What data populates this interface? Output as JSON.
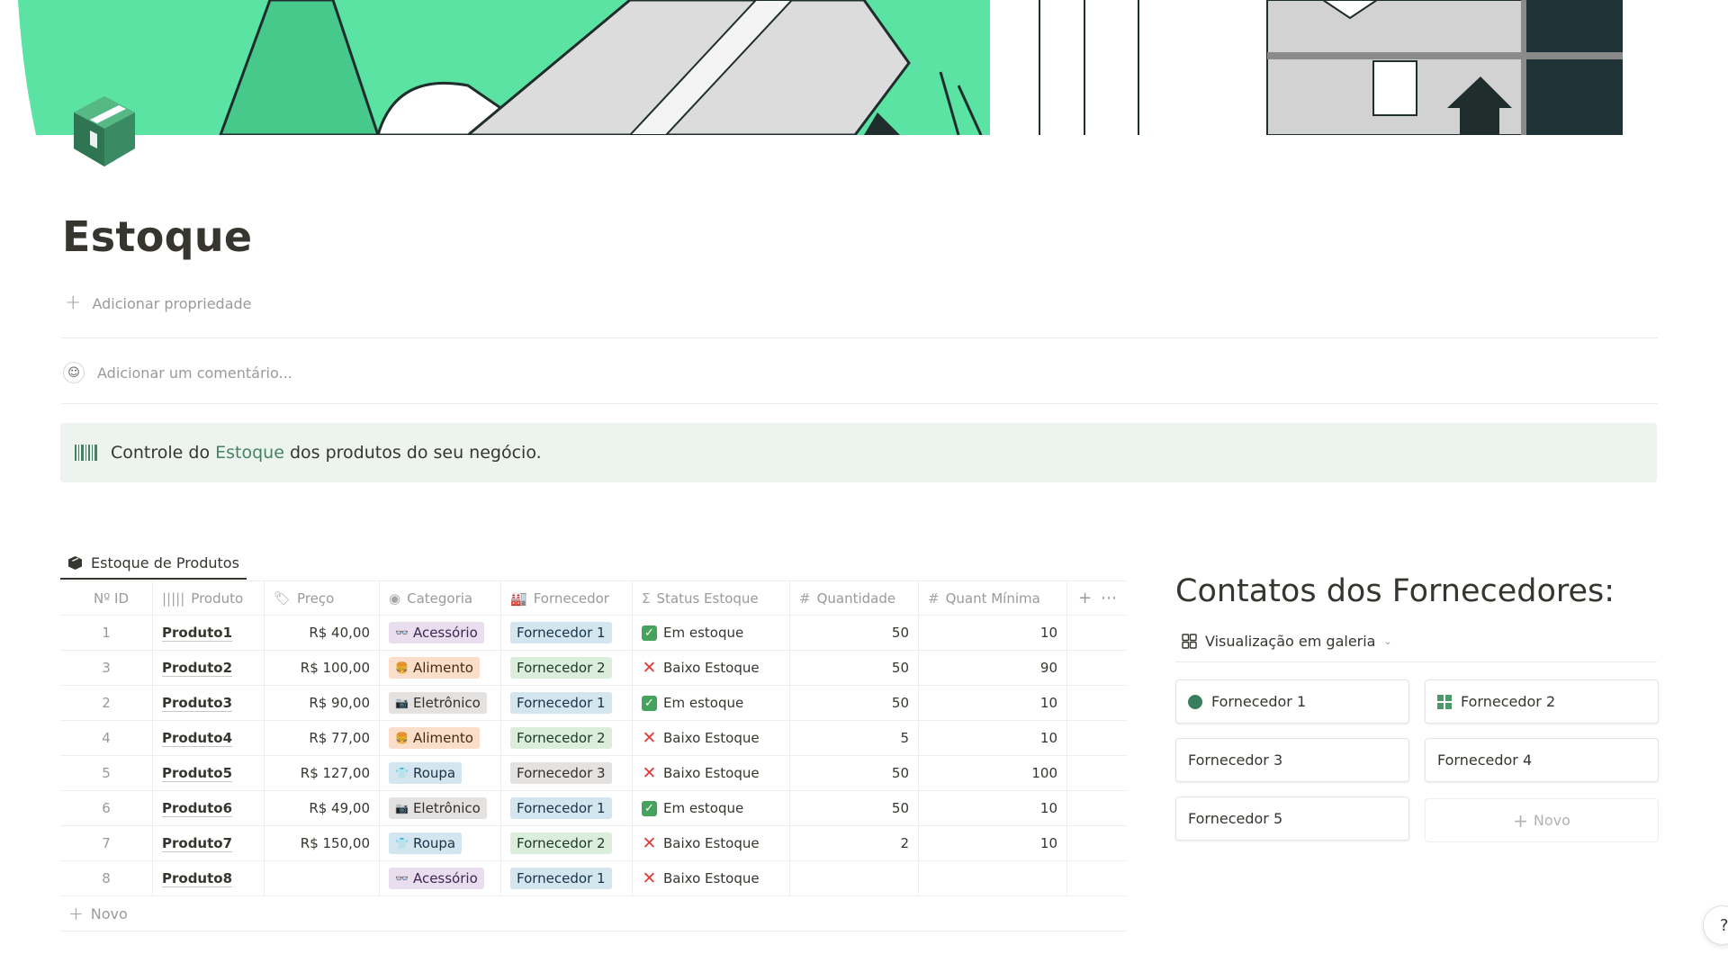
{
  "page": {
    "title": "Estoque",
    "add_property": "Adicionar propriedade",
    "comment_placeholder": "Adicionar um comentário..."
  },
  "callout": {
    "text_before": "Controle do ",
    "highlight": "Estoque",
    "text_after": " dos produtos do seu negócio."
  },
  "database": {
    "tab_label": "Estoque de Produtos",
    "headers": {
      "id": "Nº ID",
      "produto": "Produto",
      "preco": "Preço",
      "categoria": "Categoria",
      "fornecedor": "Fornecedor",
      "status": "Status Estoque",
      "quantidade": "Quantidade",
      "minima": "Quant Mínima"
    },
    "rows": [
      {
        "id": "1",
        "produto": "Produto1",
        "preco": "R$ 40,00",
        "categoria": "Acessório",
        "fornecedor": "Fornecedor 1",
        "status": "Em estoque",
        "quantidade": "50",
        "minima": "10"
      },
      {
        "id": "3",
        "produto": "Produto2",
        "preco": "R$ 100,00",
        "categoria": "Alimento",
        "fornecedor": "Fornecedor 2",
        "status": "Baixo Estoque",
        "quantidade": "50",
        "minima": "90"
      },
      {
        "id": "2",
        "produto": "Produto3",
        "preco": "R$ 90,00",
        "categoria": "Eletrônico",
        "fornecedor": "Fornecedor 1",
        "status": "Em estoque",
        "quantidade": "50",
        "minima": "10"
      },
      {
        "id": "4",
        "produto": "Produto4",
        "preco": "R$ 77,00",
        "categoria": "Alimento",
        "fornecedor": "Fornecedor 2",
        "status": "Baixo Estoque",
        "quantidade": "5",
        "minima": "10"
      },
      {
        "id": "5",
        "produto": "Produto5",
        "preco": "R$ 127,00",
        "categoria": "Roupa",
        "fornecedor": "Fornecedor 3",
        "status": "Baixo Estoque",
        "quantidade": "50",
        "minima": "100"
      },
      {
        "id": "6",
        "produto": "Produto6",
        "preco": "R$ 49,00",
        "categoria": "Eletrônico",
        "fornecedor": "Fornecedor 1",
        "status": "Em estoque",
        "quantidade": "50",
        "minima": "10"
      },
      {
        "id": "7",
        "produto": "Produto7",
        "preco": "R$ 150,00",
        "categoria": "Roupa",
        "fornecedor": "Fornecedor 2",
        "status": "Baixo Estoque",
        "quantidade": "2",
        "minima": "10"
      },
      {
        "id": "8",
        "produto": "Produto8",
        "preco": "",
        "categoria": "Acessório",
        "fornecedor": "Fornecedor 1",
        "status": "Baixo Estoque",
        "quantidade": "",
        "minima": ""
      }
    ],
    "new_label": "Novo"
  },
  "contacts": {
    "title": "Contatos dos Fornecedores:",
    "view_label": "Visualização em galeria",
    "cards": [
      "Fornecedor 1",
      "Fornecedor 2",
      "Fornecedor 3",
      "Fornecedor 4",
      "Fornecedor 5"
    ],
    "new_label": "Novo"
  },
  "help_label": "?",
  "colors": {
    "cover_green": "#5be3a3",
    "callout_bg": "#edf3ee",
    "accent_green": "#448361",
    "danger_red": "#e03e3e",
    "check_green": "#46a35e"
  }
}
